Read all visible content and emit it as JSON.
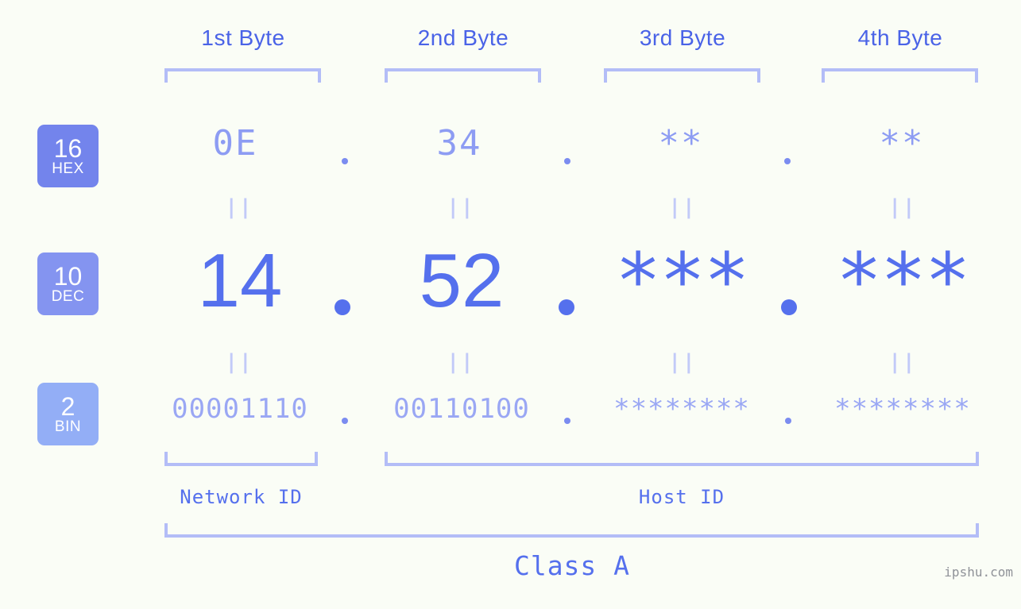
{
  "meta": {
    "background": "#fafdf6",
    "accent_dark": "#5570ed",
    "accent_mid": "#8d9cf3",
    "accent_light": "#b3bdf7",
    "watermark": "ipshu.com"
  },
  "byte_headers": [
    {
      "label": "1st Byte"
    },
    {
      "label": "2nd Byte"
    },
    {
      "label": "3rd Byte"
    },
    {
      "label": "4th Byte"
    }
  ],
  "bases": [
    {
      "id": "hex",
      "number": "16",
      "name": "HEX",
      "color": "#7384ec"
    },
    {
      "id": "dec",
      "number": "10",
      "name": "DEC",
      "color": "#8494f0"
    },
    {
      "id": "bin",
      "number": "2",
      "name": "BIN",
      "color": "#93aef6"
    }
  ],
  "rows": {
    "hex": {
      "values": [
        "0E",
        "34",
        "**",
        "**"
      ]
    },
    "dec": {
      "values": [
        "14",
        "52",
        "***",
        "***"
      ]
    },
    "bin": {
      "values": [
        "00001110",
        "00110100",
        "********",
        "********"
      ]
    }
  },
  "separators": {
    "hex": [
      ".",
      ".",
      "."
    ],
    "dec": [
      ".",
      ".",
      "."
    ],
    "bin": [
      ".",
      ".",
      "."
    ]
  },
  "equality_marks": {
    "symbol": "||",
    "between_hex_dec": [
      "||",
      "||",
      "||",
      "||"
    ],
    "between_dec_bin": [
      "||",
      "||",
      "||",
      "||"
    ]
  },
  "sections": [
    {
      "id": "network-id",
      "label": "Network ID"
    },
    {
      "id": "host-id",
      "label": "Host ID"
    }
  ],
  "class": {
    "label": "Class A"
  },
  "watermark": {
    "text": "ipshu.com"
  },
  "address": {
    "hex": "0E.34.**.**",
    "dec": "14.52.***.***",
    "bin": "00001110.00110100.********.********"
  }
}
